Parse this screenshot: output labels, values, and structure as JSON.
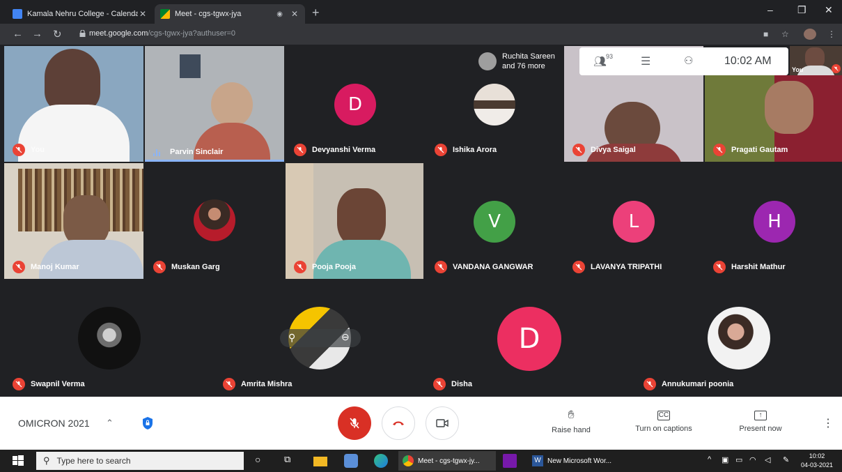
{
  "browser": {
    "tabs": [
      {
        "title": "Kamala Nehru College - Calenda",
        "active": false
      },
      {
        "title": "Meet - cgs-tgwx-jya",
        "active": true
      }
    ],
    "url_domain": "meet.google.com",
    "url_path": "/cgs-tgwx-jya?authuser=0"
  },
  "meet": {
    "participants": [
      {
        "name": "You",
        "muted": true
      },
      {
        "name": "Parvin Sinclair",
        "muted": false,
        "speaking": true
      },
      {
        "name": "Devyanshi Verma",
        "muted": true,
        "initial": "D",
        "color": "#d81b60"
      },
      {
        "name": "Ishika Arora",
        "muted": true
      },
      {
        "name": "Divya Saigal",
        "muted": true
      },
      {
        "name": "Pragati Gautam",
        "muted": true
      },
      {
        "name": "Manoj Kumar",
        "muted": true
      },
      {
        "name": "Muskan Garg",
        "muted": true
      },
      {
        "name": "Pooja Pooja",
        "muted": true
      },
      {
        "name": "VANDANA GANGWAR",
        "muted": true,
        "initial": "V",
        "color": "#43a047"
      },
      {
        "name": "LAVANYA TRIPATHI",
        "muted": true,
        "initial": "L",
        "color": "#ec407a"
      },
      {
        "name": "Harshit Mathur",
        "muted": true,
        "initial": "H",
        "color": "#9c27b0"
      },
      {
        "name": "Swapnil Verma",
        "muted": true
      },
      {
        "name": "Amrita Mishra",
        "muted": true
      },
      {
        "name": "Disha",
        "muted": true,
        "initial": "D",
        "color": "#ec2f61"
      },
      {
        "name": "Annukumari poonia",
        "muted": true
      }
    ],
    "more_participants": {
      "line1": "Ruchita Sareen",
      "line2": "and 76 more"
    },
    "participant_count": "93",
    "time": "10:02 AM",
    "self_preview_label": "You",
    "meeting_name": "OMICRON 2021",
    "actions": {
      "raise_hand": "Raise hand",
      "captions": "Turn on captions",
      "present": "Present now"
    }
  },
  "taskbar": {
    "search_placeholder": "Type here to search",
    "apps": [
      {
        "label": "Meet - cgs-tgwx-jy..."
      },
      {
        "label": "New Microsoft Wor..."
      }
    ],
    "clock_time": "10:02",
    "clock_date": "04-03-2021"
  },
  "colors": {
    "meet_bg": "#202124",
    "tile_bg": "#3c4043",
    "mute_red": "#ea4335",
    "end_call": "#d93025",
    "speaking_blue": "#8ab4f8"
  }
}
